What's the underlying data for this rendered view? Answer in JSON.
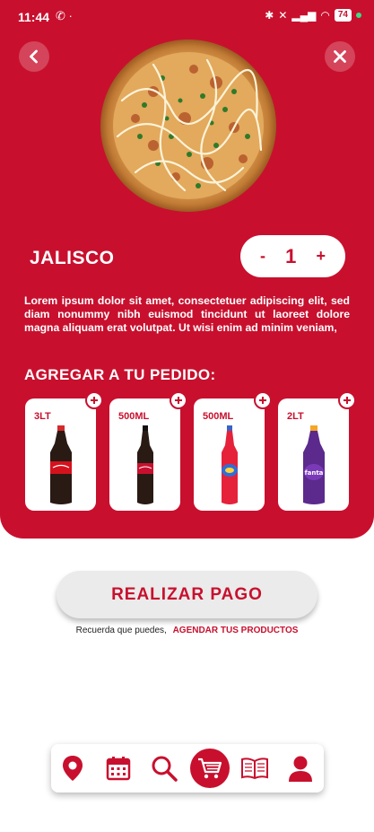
{
  "status_bar": {
    "time": "11:44",
    "battery": "74"
  },
  "product": {
    "name": "JALISCO",
    "quantity": "1",
    "decrement_label": "-",
    "increment_label": "+",
    "description": "Lorem ipsum dolor sit amet, consectetuer adipiscing elit, sed diam nonummy nibh euismod tincidunt ut laoreet dolore magna aliquam erat volutpat. Ut wisi enim ad minim veniam,"
  },
  "addons": {
    "title": "AGREGAR A TU PEDIDO:",
    "items": [
      {
        "size": "3LT",
        "icon": "coca-cola-bottle-icon"
      },
      {
        "size": "500ML",
        "icon": "coca-cola-zero-bottle-icon"
      },
      {
        "size": "500ML",
        "icon": "fanta-red-bottle-icon"
      },
      {
        "size": "2LT",
        "icon": "fanta-grape-bottle-icon"
      }
    ]
  },
  "checkout": {
    "pay_label": "REALIZAR PAGO",
    "reminder_text": "Recuerda que puedes,",
    "reminder_link": "AGENDAR TUS PRODUCTOS"
  },
  "navbar": {
    "items": [
      "location-icon",
      "calendar-icon",
      "search-icon",
      "cart-icon",
      "menu-book-icon",
      "profile-icon"
    ]
  },
  "colors": {
    "brand": "#c8102e",
    "background": "#ffffff",
    "button_bg": "#ebebeb"
  }
}
